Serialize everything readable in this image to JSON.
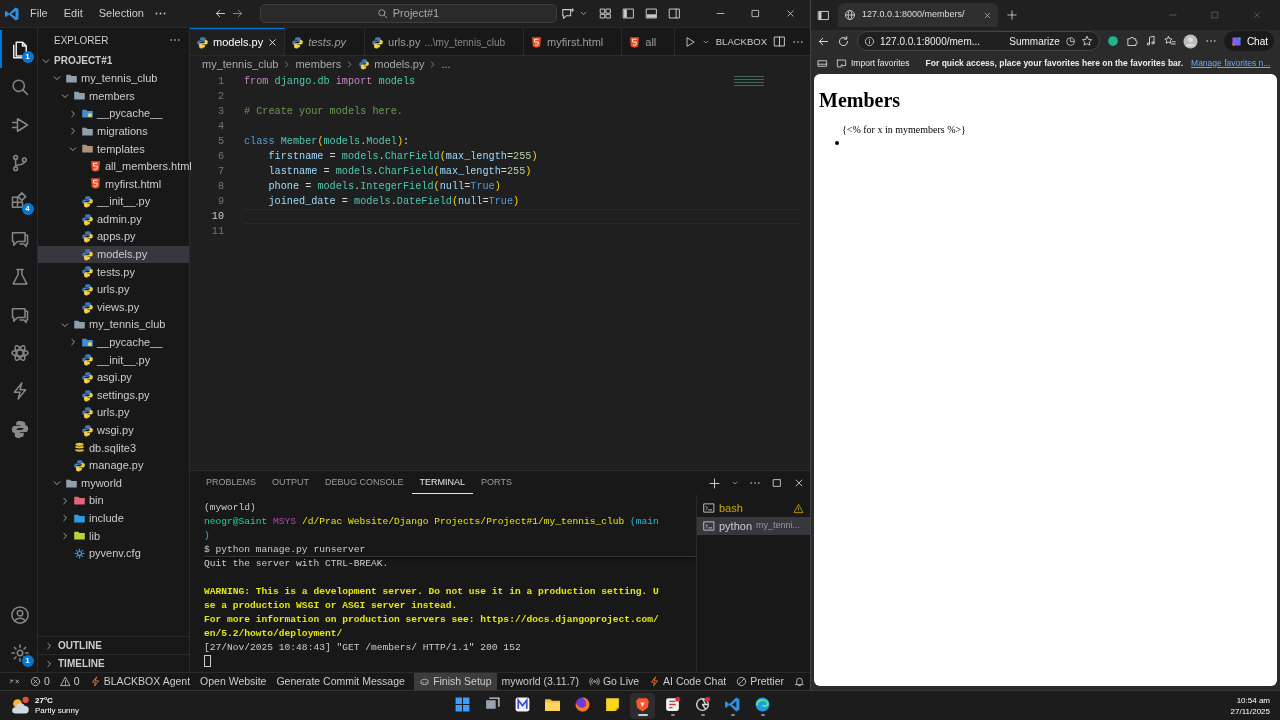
{
  "vscode": {
    "menu": [
      "File",
      "Edit",
      "Selection"
    ],
    "command_center": "Project#1",
    "activity_bar": [
      {
        "kind": "files",
        "badge": "1",
        "selected": true
      },
      {
        "kind": "search",
        "selected": false
      },
      {
        "kind": "debug",
        "selected": false
      },
      {
        "kind": "branch",
        "selected": false
      },
      {
        "kind": "extensions",
        "badge": "4",
        "selected": false
      },
      {
        "kind": "chat",
        "selected": false
      },
      {
        "kind": "flask",
        "selected": false
      },
      {
        "kind": "chat",
        "selected": false
      },
      {
        "kind": "atom",
        "selected": false
      },
      {
        "kind": "bolt",
        "selected": false
      },
      {
        "kind": "python",
        "selected": false
      }
    ],
    "activity_bottom": [
      {
        "kind": "account"
      },
      {
        "kind": "gear",
        "badge": "1"
      }
    ],
    "explorer": {
      "title": "EXPLORER",
      "root": "PROJECT#1",
      "root_expanded": true,
      "tree": [
        {
          "label": "my_tennis_club",
          "kind": "folder",
          "expanded": true,
          "selected": false,
          "children": [
            {
              "label": "members",
              "kind": "folder",
              "expanded": true,
              "selected": false,
              "children": [
                {
                  "label": "__pycache__",
                  "kind": "pycache",
                  "expanded": false,
                  "selected": false
                },
                {
                  "label": "migrations",
                  "kind": "folder",
                  "expanded": false,
                  "selected": false
                },
                {
                  "label": "templates",
                  "kind": "templates",
                  "expanded": true,
                  "selected": false,
                  "children": [
                    {
                      "label": "all_members.html",
                      "kind": "html",
                      "selected": false
                    },
                    {
                      "label": "myfirst.html",
                      "kind": "html",
                      "selected": false
                    }
                  ]
                },
                {
                  "label": "__init__.py",
                  "kind": "python",
                  "selected": false
                },
                {
                  "label": "admin.py",
                  "kind": "python",
                  "selected": false
                },
                {
                  "label": "apps.py",
                  "kind": "python",
                  "selected": false
                },
                {
                  "label": "models.py",
                  "kind": "python",
                  "selected": true
                },
                {
                  "label": "tests.py",
                  "kind": "python",
                  "selected": false
                },
                {
                  "label": "urls.py",
                  "kind": "python",
                  "selected": false
                },
                {
                  "label": "views.py",
                  "kind": "python",
                  "selected": false
                }
              ]
            },
            {
              "label": "my_tennis_club",
              "kind": "folder",
              "expanded": true,
              "selected": false,
              "children": [
                {
                  "label": "__pycache__",
                  "kind": "pycache",
                  "expanded": false,
                  "selected": false
                },
                {
                  "label": "__init__.py",
                  "kind": "python",
                  "selected": false
                },
                {
                  "label": "asgi.py",
                  "kind": "python",
                  "selected": false
                },
                {
                  "label": "settings.py",
                  "kind": "python",
                  "selected": false
                },
                {
                  "label": "urls.py",
                  "kind": "python",
                  "selected": false
                },
                {
                  "label": "wsgi.py",
                  "kind": "python",
                  "selected": false
                }
              ]
            },
            {
              "label": "db.sqlite3",
              "kind": "db",
              "selected": false
            },
            {
              "label": "manage.py",
              "kind": "python",
              "selected": false
            }
          ]
        },
        {
          "label": "myworld",
          "kind": "folder",
          "expanded": true,
          "selected": false,
          "children": [
            {
              "label": "bin",
              "kind": "bin",
              "expanded": false,
              "selected": false
            },
            {
              "label": "include",
              "kind": "include",
              "expanded": false,
              "selected": false
            },
            {
              "label": "lib",
              "kind": "lib",
              "expanded": false,
              "selected": false
            },
            {
              "label": "pyvenv.cfg",
              "kind": "cfg",
              "selected": false
            }
          ]
        }
      ],
      "sections": [
        {
          "label": "OUTLINE",
          "expanded": false
        },
        {
          "label": "TIMELINE",
          "expanded": false
        }
      ]
    },
    "tabs": [
      {
        "label": "models.py",
        "kind": "python",
        "selected": true,
        "italic": false
      },
      {
        "label": "tests.py",
        "kind": "python",
        "selected": false,
        "italic": true
      },
      {
        "label": "urls.py",
        "description": "...\\my_tennis_club",
        "kind": "python",
        "selected": false,
        "italic": false
      },
      {
        "label": "myfirst.html",
        "kind": "html",
        "selected": false,
        "italic": false
      },
      {
        "label": "all",
        "kind": "html",
        "selected": false,
        "italic": false
      }
    ],
    "editor_action": "BLACKBOX",
    "breadcrumb": [
      "my_tennis_club",
      "members",
      "models.py",
      "..."
    ],
    "code": [
      {
        "number": "1",
        "current": false,
        "tokens": [
          {
            "t": "from",
            "kind": "kw"
          },
          {
            "t": " django.db",
            "kind": "mod"
          },
          {
            "t": " import",
            "kind": "kw"
          },
          {
            "t": " models",
            "kind": "mod"
          }
        ]
      },
      {
        "number": "2",
        "current": false
      },
      {
        "number": "3",
        "current": false,
        "tokens": [
          {
            "t": "# Create your models here.",
            "kind": "cmt"
          }
        ]
      },
      {
        "number": "4",
        "current": false
      },
      {
        "number": "5",
        "current": false,
        "tokens": [
          {
            "t": "class",
            "kind": "store"
          },
          {
            "t": " Member",
            "kind": "cls"
          },
          {
            "t": "(",
            "kind": "br1"
          },
          {
            "t": "models",
            "kind": "mod"
          },
          {
            "t": ".",
            "kind": "op"
          },
          {
            "t": "Model",
            "kind": "cls"
          },
          {
            "t": ")",
            "kind": "br1"
          },
          {
            "t": ":",
            "kind": "op"
          }
        ]
      },
      {
        "number": "6",
        "current": false,
        "tokens": [
          {
            "t": "    firstname",
            "kind": "var"
          },
          {
            "t": " =",
            "kind": "op"
          },
          {
            "t": " models",
            "kind": "mod"
          },
          {
            "t": ".",
            "kind": "op"
          },
          {
            "t": "CharField",
            "kind": "cls"
          },
          {
            "t": "(",
            "kind": "br1"
          },
          {
            "t": "max_length",
            "kind": "var"
          },
          {
            "t": "=",
            "kind": "op"
          },
          {
            "t": "255",
            "kind": "num"
          },
          {
            "t": ")",
            "kind": "br1"
          }
        ]
      },
      {
        "number": "7",
        "current": false,
        "tokens": [
          {
            "t": "    lastname",
            "kind": "var"
          },
          {
            "t": " =",
            "kind": "op"
          },
          {
            "t": " models",
            "kind": "mod"
          },
          {
            "t": ".",
            "kind": "op"
          },
          {
            "t": "CharField",
            "kind": "cls"
          },
          {
            "t": "(",
            "kind": "br1"
          },
          {
            "t": "max_length",
            "kind": "var"
          },
          {
            "t": "=",
            "kind": "op"
          },
          {
            "t": "255",
            "kind": "num"
          },
          {
            "t": ")",
            "kind": "br1"
          }
        ]
      },
      {
        "number": "8",
        "current": false,
        "tokens": [
          {
            "t": "    phone",
            "kind": "var"
          },
          {
            "t": " =",
            "kind": "op"
          },
          {
            "t": " models",
            "kind": "mod"
          },
          {
            "t": ".",
            "kind": "op"
          },
          {
            "t": "IntegerField",
            "kind": "cls"
          },
          {
            "t": "(",
            "kind": "br1"
          },
          {
            "t": "null",
            "kind": "var"
          },
          {
            "t": "=",
            "kind": "op"
          },
          {
            "t": "True",
            "kind": "store"
          },
          {
            "t": ")",
            "kind": "br1"
          }
        ]
      },
      {
        "number": "9",
        "current": false,
        "tokens": [
          {
            "t": "    joined_date",
            "kind": "var"
          },
          {
            "t": " =",
            "kind": "op"
          },
          {
            "t": " models",
            "kind": "mod"
          },
          {
            "t": ".",
            "kind": "op"
          },
          {
            "t": "DateField",
            "kind": "cls"
          },
          {
            "t": "(",
            "kind": "br1"
          },
          {
            "t": "null",
            "kind": "var"
          },
          {
            "t": "=",
            "kind": "op"
          },
          {
            "t": "True",
            "kind": "store"
          },
          {
            "t": ")",
            "kind": "br1"
          }
        ]
      },
      {
        "number": "10",
        "current": true
      },
      {
        "number": "11",
        "current": false
      }
    ],
    "panel": {
      "tabs": [
        {
          "label": "PROBLEMS",
          "selected": false
        },
        {
          "label": "OUTPUT",
          "selected": false
        },
        {
          "label": "DEBUG CONSOLE",
          "selected": false
        },
        {
          "label": "TERMINAL",
          "selected": true
        },
        {
          "label": "PORTS",
          "selected": false
        }
      ],
      "terminal": [
        {
          "segments": [
            {
              "t": "(myworld)",
              "kind": "plain"
            }
          ],
          "sticky": false
        },
        {
          "segments": [
            {
              "t": "neogr@Saint",
              "kind": "green"
            },
            {
              "t": " MSYS",
              "kind": "magenta"
            },
            {
              "t": " /d/Prac Website/Django Projects/Project#1/my_tennis_club",
              "kind": "yellow"
            },
            {
              "t": " (main",
              "kind": "cyan"
            }
          ],
          "sticky": false
        },
        {
          "segments": [
            {
              "t": ")",
              "kind": "cyan"
            }
          ],
          "sticky": false
        },
        {
          "segments": [
            {
              "t": "$ python manage.py runserver",
              "kind": "plain"
            }
          ],
          "sticky": true
        },
        {
          "segments": [
            {
              "t": "Quit the server with CTRL-BREAK.",
              "kind": "plain"
            }
          ],
          "sticky": false
        },
        {
          "segments": [
            {
              "t": "WARNING: This is a development server. Do not use it in a production setting. U",
              "kind": "warn"
            }
          ],
          "sticky": false,
          "blank_line_before": true
        },
        {
          "segments": [
            {
              "t": "se a production WSGI or ASGI server instead.",
              "kind": "warn"
            }
          ],
          "sticky": false
        },
        {
          "segments": [
            {
              "t": "For more information on production servers see: https://docs.djangoproject.com/",
              "kind": "warn"
            }
          ],
          "sticky": false
        },
        {
          "segments": [
            {
              "t": "en/5.2/howto/deployment/",
              "kind": "warn"
            }
          ],
          "sticky": false
        },
        {
          "segments": [
            {
              "t": "[27/Nov/2025 10:48:43] \"GET /members/ HTTP/1.1\" 200 152",
              "kind": "plain"
            }
          ],
          "sticky": false
        }
      ],
      "terminals": [
        {
          "label": "bash",
          "warning": true,
          "selected": false
        },
        {
          "label": "python",
          "description": "my_tenni...",
          "warning": false,
          "selected": true
        }
      ]
    },
    "status_bar": [
      {
        "kind": "remote",
        "highlighted": false
      },
      {
        "kind": "error",
        "label": "0",
        "highlighted": false
      },
      {
        "kind": "warning",
        "label": "0",
        "highlighted": false
      },
      {
        "kind": "bolt",
        "label": "BLACKBOX Agent",
        "highlighted": false
      },
      {
        "label": "Open Website",
        "highlighted": false
      },
      {
        "label": "Generate Commit Message",
        "highlighted": false
      },
      {
        "kind": "copilot",
        "label": "Finish Setup",
        "highlighted": true
      },
      {
        "label": "myworld (3.11.7)",
        "highlighted": false
      },
      {
        "kind": "broadcast",
        "label": "Go Live",
        "highlighted": false
      },
      {
        "kind": "bolt",
        "label": "AI Code Chat",
        "highlighted": false
      },
      {
        "kind": "nosign",
        "label": "Prettier",
        "highlighted": false
      },
      {
        "kind": "bell",
        "highlighted": false
      }
    ]
  },
  "browser": {
    "tab_title": "127.0.0.1:8000/members/",
    "address": "127.0.0.1:8000/mem...",
    "summarize": "Summarize",
    "chat": "Chat",
    "favorites": {
      "import": "Import favorites",
      "message": "For quick access, place your favorites here on the favorites bar.",
      "link": "Manage favorites n..."
    },
    "page": {
      "heading": "Members",
      "loop_text": "{<% for x in mymembers %>}"
    }
  },
  "taskbar": {
    "weather": {
      "temp": "27°C",
      "desc": "Partly sunny"
    },
    "apps": [
      {
        "kind": "windows",
        "selected": false,
        "running": false
      },
      {
        "kind": "taskview",
        "selected": false,
        "running": false
      },
      {
        "kind": "mapp",
        "selected": false,
        "running": false
      },
      {
        "kind": "folder",
        "selected": false,
        "running": false
      },
      {
        "kind": "firefox",
        "selected": false,
        "running": false
      },
      {
        "kind": "notes",
        "selected": false,
        "running": false
      },
      {
        "kind": "brave",
        "selected": true,
        "running": true
      },
      {
        "kind": "snip",
        "selected": false,
        "running": true
      },
      {
        "kind": "aperture",
        "selected": false,
        "running": true
      },
      {
        "kind": "vscode",
        "selected": false,
        "running": true
      },
      {
        "kind": "edge",
        "selected": false,
        "running": true
      }
    ],
    "time": "10:54 am",
    "date": "27/11/2025"
  }
}
